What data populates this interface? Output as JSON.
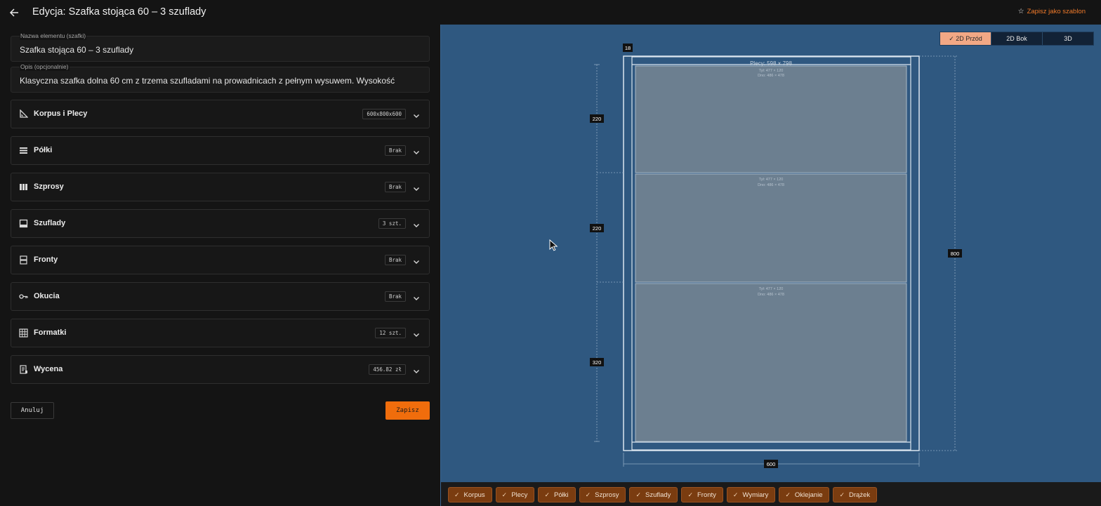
{
  "header": {
    "title": "Edycja: Szafka stojąca 60 – 3 szuflady",
    "save_template_label": "Zapisz jako szablon"
  },
  "form": {
    "name_label": "Nazwa elementu (szafki)",
    "name_value": "Szafka stojąca 60 – 3 szuflady",
    "desc_label": "Opis (opcjonalnie)",
    "desc_value": "Klasyczna szafka dolna 60 cm z trzema szufladami na prowadnicach z pełnym wysuwem. Wysokość"
  },
  "sections": [
    {
      "label": "Korpus i Plecy",
      "badge": "600x800x600",
      "icon": "set-square-icon"
    },
    {
      "label": "Półki",
      "badge": "Brak",
      "icon": "shelves-icon"
    },
    {
      "label": "Szprosy",
      "badge": "Brak",
      "icon": "dividers-icon"
    },
    {
      "label": "Szuflady",
      "badge": "3 szt.",
      "icon": "drawer-icon"
    },
    {
      "label": "Fronty",
      "badge": "Brak",
      "icon": "fronts-icon"
    },
    {
      "label": "Okucia",
      "badge": "Brak",
      "icon": "key-icon"
    },
    {
      "label": "Formatki",
      "badge": "12 szt.",
      "icon": "grid-icon"
    },
    {
      "label": "Wycena",
      "badge": "456.82 zł",
      "icon": "receipt-icon"
    }
  ],
  "actions": {
    "cancel_label": "Anuluj",
    "save_label": "Zapisz"
  },
  "view_toggle": {
    "options": [
      "2D Przód",
      "2D Bok",
      "3D"
    ],
    "active": "2D Przód",
    "active_mark": "✓"
  },
  "drawing": {
    "back_panel_label": "Plecy: 598 × 798",
    "drawer_labels": [
      {
        "line1": "Tył: 477 × 120",
        "line2": "Dno: 486 × 478"
      },
      {
        "line1": "Tył: 477 × 120",
        "line2": "Dno: 486 × 478"
      },
      {
        "line1": "Tył: 477 × 120",
        "line2": "Dno: 486 × 478"
      }
    ],
    "dim_thickness": "18",
    "dim_drawers": [
      "220",
      "220",
      "320"
    ],
    "dim_height": "800",
    "dim_width": "600"
  },
  "layer_chips": [
    "Korpus",
    "Plecy",
    "Półki",
    "Szprosy",
    "Szuflady",
    "Fronty",
    "Wymiary",
    "Oklejanie",
    "Drążek"
  ],
  "colors": {
    "accent": "#f06d0c",
    "canvas_bg": "#2f5880",
    "panel_bg": "#141414",
    "chip_bg": "#7a3c10"
  }
}
